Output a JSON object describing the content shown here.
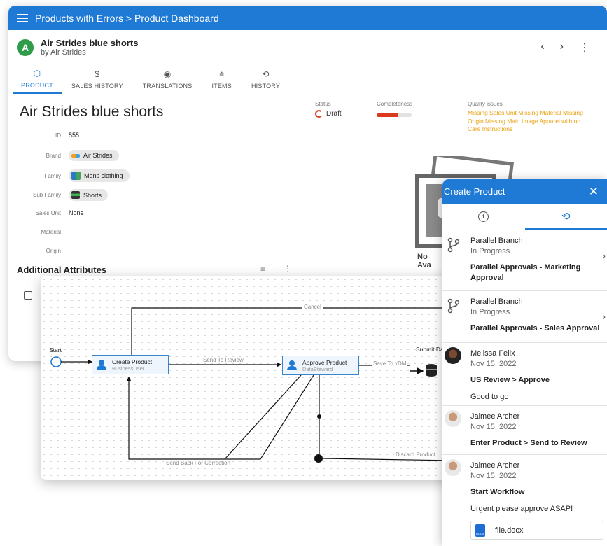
{
  "appbar": {
    "title": "Products with Errors > Product Dashboard"
  },
  "product": {
    "avatar_letter": "A",
    "name": "Air Strides blue shorts",
    "by_line": "by Air Strides",
    "big_title": "Air Strides blue shorts"
  },
  "header_nav": {
    "prev": "‹",
    "next": "›",
    "more": "⋮"
  },
  "tabs": [
    {
      "label": "PRODUCT",
      "icon": "cube-icon",
      "glyph": "⬡"
    },
    {
      "label": "SALES HISTORY",
      "icon": "dollar-icon",
      "glyph": "$"
    },
    {
      "label": "TRANSLATIONS",
      "icon": "globe-icon",
      "glyph": "◉"
    },
    {
      "label": "ITEMS",
      "icon": "items-icon",
      "glyph": "⩮"
    },
    {
      "label": "HISTORY",
      "icon": "history-icon",
      "glyph": "⟲"
    }
  ],
  "status": {
    "label": "Status",
    "value": "Draft"
  },
  "completeness": {
    "label": "Completeness",
    "fraction": 0.6
  },
  "quality": {
    "label": "Quality issues",
    "text": "Missing Sales Unit Missing Material Missing Origin Missing Main Image Apparel with no Care Instructions"
  },
  "attributes": [
    {
      "label": "ID",
      "value": "555",
      "chip": false
    },
    {
      "label": "Brand",
      "value": "Air Strides",
      "chip": true,
      "icon": "brand-logo-icon"
    },
    {
      "label": "Family",
      "value": "Mens clothing",
      "chip": true,
      "icon": "family-icon"
    },
    {
      "label": "Sub Family",
      "value": "Shorts",
      "chip": true,
      "icon": "subfamily-icon"
    },
    {
      "label": "Sales Unit",
      "value": "None",
      "chip": false
    },
    {
      "label": "Material",
      "value": "",
      "chip": false
    },
    {
      "label": "Origin",
      "value": "",
      "chip": false
    }
  ],
  "additional": {
    "title": "Additional Attributes",
    "filter_icon": "≡",
    "more_icon": "⋮"
  },
  "placeholder_image": {
    "line1": "No",
    "line2": "Ava"
  },
  "workflow": {
    "start": "Start",
    "submit": "Submit Data",
    "nodes": [
      {
        "title": "Create Product",
        "role": "BusinessUser"
      },
      {
        "title": "Approve Product",
        "role": "DataSteward"
      }
    ],
    "edges": {
      "cancel": "Cancel",
      "send_to_review": "Send To Review",
      "save_to_xdm": "Save To xDM",
      "send_back": "Send Back For Correction",
      "discard": "Discard Product"
    }
  },
  "panel": {
    "title": "Create Product",
    "close": "✕",
    "entries": [
      {
        "line1": "Parallel Branch",
        "line2": "In Progress",
        "step": "Parallel Approvals - Marketing Approval",
        "comment": ""
      },
      {
        "line1": "Parallel Branch",
        "line2": "In Progress",
        "step": "Parallel Approvals - Sales Approval",
        "comment": ""
      },
      {
        "line1": "Melissa Felix",
        "line2": "Nov 15, 2022",
        "step": "US Review > Approve",
        "comment": "Good to go"
      },
      {
        "line1": "Jaimee Archer",
        "line2": "Nov 15, 2022",
        "step": "Enter Product > Send to Review",
        "comment": ""
      },
      {
        "line1": "Jaimee Archer",
        "line2": "Nov 15, 2022",
        "step": "Start Workflow",
        "comment": "Urgent please approve ASAP!"
      }
    ],
    "file": {
      "name": "file.docx",
      "icon_text": "DOCX"
    }
  },
  "colors": {
    "primary": "#1f7ad6",
    "warning": "#e8a111",
    "error": "#d93a1e",
    "success": "#2e9c48"
  }
}
